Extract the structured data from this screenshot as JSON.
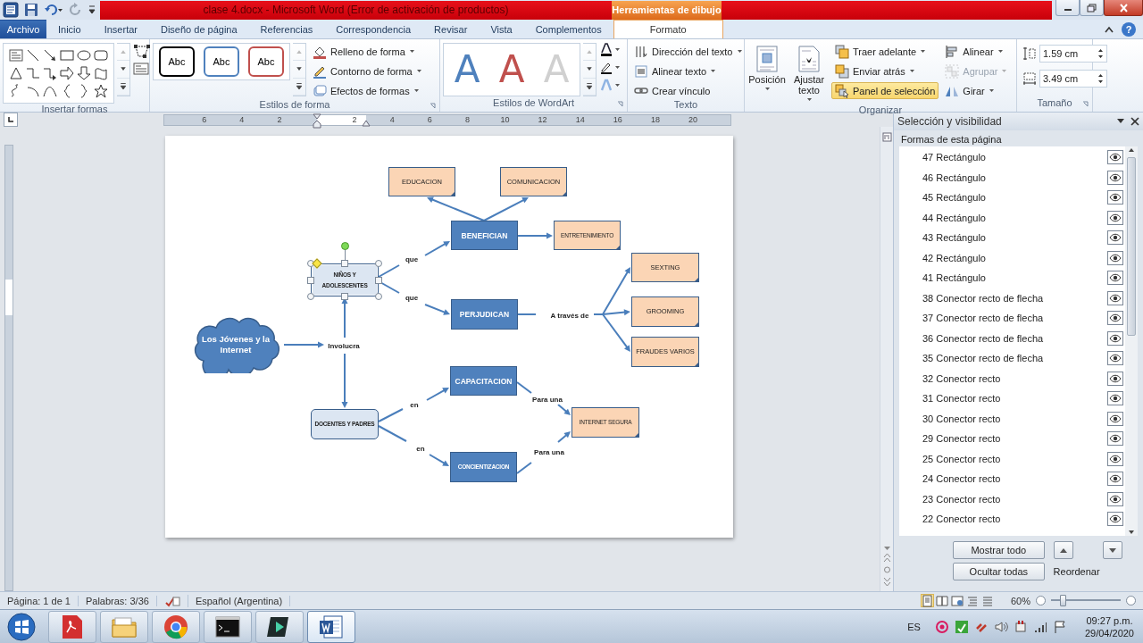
{
  "window": {
    "title": "clase 4.docx  -  Microsoft Word (Error de activación de productos)",
    "context_label": "Herramientas de dibujo",
    "help": "?"
  },
  "tabs": [
    {
      "label": "Archivo",
      "kind": "file",
      "selected": false
    },
    {
      "label": "Inicio",
      "kind": "tab",
      "selected": false
    },
    {
      "label": "Insertar",
      "kind": "tab",
      "selected": false
    },
    {
      "label": "Diseño de página",
      "kind": "tab",
      "selected": false
    },
    {
      "label": "Referencias",
      "kind": "tab",
      "selected": false
    },
    {
      "label": "Correspondencia",
      "kind": "tab",
      "selected": false
    },
    {
      "label": "Revisar",
      "kind": "tab",
      "selected": false
    },
    {
      "label": "Vista",
      "kind": "tab",
      "selected": false
    },
    {
      "label": "Complementos",
      "kind": "tab",
      "selected": false
    },
    {
      "label": "Formato",
      "kind": "context",
      "selected": true
    }
  ],
  "ribbon": [
    {
      "kind": "shapes",
      "label": "Insertar formas"
    },
    {
      "kind": "styles",
      "label": "Estilos de forma",
      "presets": [
        {
          "label": "Abc",
          "color": "#000000"
        },
        {
          "label": "Abc",
          "color": "#4f81bd"
        },
        {
          "label": "Abc",
          "color": "#c0504d"
        }
      ],
      "commands": [
        {
          "label": "Relleno de forma",
          "dropdown": true,
          "selected": false,
          "disabled": false
        },
        {
          "label": "Contorno de forma",
          "dropdown": true,
          "selected": false,
          "disabled": false
        },
        {
          "label": "Efectos de formas",
          "dropdown": true,
          "selected": false,
          "disabled": false
        }
      ]
    },
    {
      "kind": "wordart",
      "label": "Estilos de WordArt",
      "presets": [
        {
          "label": "A",
          "color": "#4f81bd"
        },
        {
          "label": "A",
          "color": "#c0504d"
        },
        {
          "label": "A",
          "color": "#d0d0d0"
        }
      ]
    },
    {
      "kind": "commands",
      "label": "Texto",
      "commands": [
        {
          "label": "Dirección del texto",
          "dropdown": true,
          "selected": false,
          "disabled": false
        },
        {
          "label": "Alinear texto",
          "dropdown": true,
          "selected": false,
          "disabled": false
        },
        {
          "label": "Crear vínculo",
          "dropdown": false,
          "selected": false,
          "disabled": false
        }
      ]
    },
    {
      "kind": "arrange",
      "label": "Organizar",
      "large": [
        {
          "label": "Posición",
          "dropdown": true
        },
        {
          "label": "Ajustar texto",
          "dropdown": true
        }
      ],
      "commands": [
        {
          "label": "Traer adelante",
          "dropdown": true,
          "selected": false,
          "disabled": false
        },
        {
          "label": "Enviar atrás",
          "dropdown": true,
          "selected": false,
          "disabled": false
        },
        {
          "label": "Panel de selección",
          "dropdown": false,
          "selected": true,
          "disabled": false
        },
        {
          "label": "Alinear",
          "dropdown": true,
          "selected": false,
          "disabled": false
        },
        {
          "label": "Agrupar",
          "dropdown": true,
          "selected": false,
          "disabled": true
        },
        {
          "label": "Girar",
          "dropdown": true,
          "selected": false,
          "disabled": false
        }
      ]
    },
    {
      "kind": "size",
      "label": "Tamaño",
      "fields": [
        {
          "value": "1.59 cm"
        },
        {
          "value": "3.49 cm"
        }
      ]
    }
  ],
  "ruler": {
    "left_numbers": [
      "6",
      "4",
      "2"
    ],
    "right_numbers": [
      "2",
      "4",
      "6",
      "8",
      "10",
      "12",
      "14",
      "16",
      "18",
      "20"
    ]
  },
  "diagram": {
    "nodes": [
      {
        "kind": "note",
        "text": "EDUCACION",
        "selected": false
      },
      {
        "kind": "note",
        "text": "COMUNICACION",
        "selected": false
      },
      {
        "kind": "box",
        "text": "BENEFICIAN",
        "selected": false
      },
      {
        "kind": "note",
        "text": "ENTRETENIMIENTO",
        "selected": false
      },
      {
        "kind": "label",
        "text": "que",
        "selected": false
      },
      {
        "kind": "main",
        "text": "NIÑOS Y ADOLESCENTES",
        "selected": true
      },
      {
        "kind": "note",
        "text": "SEXTING",
        "selected": false
      },
      {
        "kind": "label",
        "text": "que",
        "selected": false
      },
      {
        "kind": "box",
        "text": "PERJUDICAN",
        "selected": false
      },
      {
        "kind": "label",
        "text": "A través de",
        "selected": false
      },
      {
        "kind": "note",
        "text": "GROOMING",
        "selected": false
      },
      {
        "kind": "cloud",
        "text": "Los Jóvenes y la Internet",
        "selected": false
      },
      {
        "kind": "label",
        "text": "Involucra",
        "selected": false
      },
      {
        "kind": "note",
        "text": "FRAUDES VARIOS",
        "selected": false
      },
      {
        "kind": "box",
        "text": "CAPACITACION",
        "selected": false
      },
      {
        "kind": "label",
        "text": "en",
        "selected": false
      },
      {
        "kind": "label",
        "text": "Para una",
        "selected": false
      },
      {
        "kind": "main",
        "text": "DOCENTES Y PADRES",
        "selected": false
      },
      {
        "kind": "note",
        "text": "INTERNET SEGURA",
        "selected": false
      },
      {
        "kind": "label",
        "text": "en",
        "selected": false
      },
      {
        "kind": "label",
        "text": "Para una",
        "selected": false
      },
      {
        "kind": "box",
        "text": "CONCIENTIZACION",
        "selected": false
      }
    ]
  },
  "pane": {
    "title": "Selección y visibilidad",
    "subtitle": "Formas de esta página",
    "shapes": [
      {
        "label": "47 Rectángulo",
        "visible": true
      },
      {
        "label": "46 Rectángulo",
        "visible": true
      },
      {
        "label": "45 Rectángulo",
        "visible": true
      },
      {
        "label": "44 Rectángulo",
        "visible": true
      },
      {
        "label": "43 Rectángulo",
        "visible": true
      },
      {
        "label": "42 Rectángulo",
        "visible": true
      },
      {
        "label": "41 Rectángulo",
        "visible": true
      },
      {
        "label": "38 Conector recto de flecha",
        "visible": true
      },
      {
        "label": "37 Conector recto de flecha",
        "visible": true
      },
      {
        "label": "36 Conector recto de flecha",
        "visible": true
      },
      {
        "label": "35 Conector recto de flecha",
        "visible": true
      },
      {
        "label": "32 Conector recto",
        "visible": true
      },
      {
        "label": "31 Conector recto",
        "visible": true
      },
      {
        "label": "30 Conector recto",
        "visible": true
      },
      {
        "label": "29 Conector recto",
        "visible": true
      },
      {
        "label": "25 Conector recto",
        "visible": true
      },
      {
        "label": "24 Conector recto",
        "visible": true
      },
      {
        "label": "23 Conector recto",
        "visible": true
      },
      {
        "label": "22 Conector recto",
        "visible": true
      }
    ],
    "buttons": [
      "Mostrar todo",
      "Ocultar todas"
    ],
    "reorder_label": "Reordenar"
  },
  "status_bar": {
    "page": "Página: 1 de 1",
    "words": "Palabras: 3/36",
    "language": "Español (Argentina)",
    "views": [
      {
        "selected": true
      },
      {
        "selected": false
      },
      {
        "selected": false
      },
      {
        "selected": false
      },
      {
        "selected": false
      }
    ],
    "zoom": "60%",
    "zoom_slider": {
      "level": 0.13
    }
  },
  "taskbar": {
    "apps": [
      {
        "kind": "pdf",
        "selected": false
      },
      {
        "kind": "folder",
        "selected": false
      },
      {
        "kind": "browser",
        "selected": false
      },
      {
        "kind": "terminal",
        "selected": false
      },
      {
        "kind": "editor",
        "selected": false
      },
      {
        "kind": "word",
        "selected": true
      }
    ],
    "language": "ES",
    "time": "09:27 p.m.",
    "date": "29/04/2020"
  }
}
